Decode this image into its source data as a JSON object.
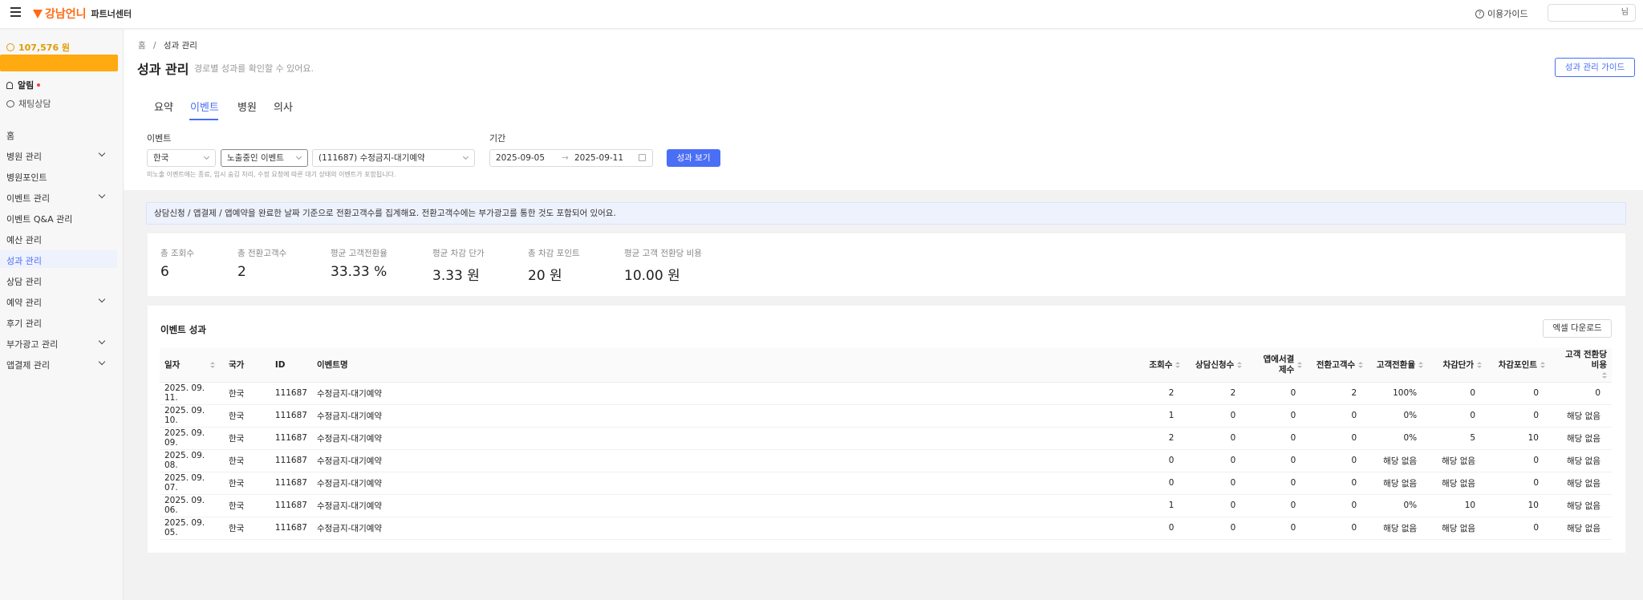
{
  "header": {
    "logo_text": "강남언니",
    "subtitle": "파트너센터",
    "guide_link": "이용가이드",
    "user_suffix": "님",
    "brand_color": "#ff6a13"
  },
  "sidebar": {
    "points": "107,576 원",
    "alarm": "알림",
    "chat": "채팅상담",
    "items": [
      {
        "label": "홈",
        "chevron": false
      },
      {
        "label": "병원 관리",
        "chevron": true
      },
      {
        "label": "병원포인트",
        "chevron": false
      },
      {
        "label": "이벤트 관리",
        "chevron": true
      },
      {
        "label": "이벤트 Q&A 관리",
        "chevron": false
      },
      {
        "label": "예산 관리",
        "chevron": false
      },
      {
        "label": "성과 관리",
        "chevron": false,
        "active": true
      },
      {
        "label": "상담 관리",
        "chevron": false
      },
      {
        "label": "예약 관리",
        "chevron": true
      },
      {
        "label": "후기 관리",
        "chevron": false
      },
      {
        "label": "부가광고 관리",
        "chevron": true
      },
      {
        "label": "앱결제 관리",
        "chevron": true
      }
    ]
  },
  "breadcrumb": {
    "home": "홈",
    "sep": "/",
    "current": "성과 관리"
  },
  "page": {
    "title": "성과 관리",
    "subtitle": "경로별 성과를 확인할 수 있어요.",
    "guide_button": "성과 관리 가이드"
  },
  "tabs": [
    "요약",
    "이벤트",
    "병원",
    "의사"
  ],
  "active_tab": "이벤트",
  "filters": {
    "event_label": "이벤트",
    "period_label": "기간",
    "country": "한국",
    "event_status": "노출중인 이벤트",
    "event_name": "(111687) 수정금지-대기예약",
    "date_from": "2025-09-05",
    "date_to": "2025-09-11",
    "view_button": "성과 보기",
    "note": "미노출 이벤트에는 종료, 임시 숨김 처리, 수정 요청에 따른 대기 상태의 이벤트가 포함됩니다."
  },
  "info_banner": "상담신청 / 앱결제 / 앱예약을 완료한 날짜 기준으로 전환고객수를 집계해요. 전환고객수에는 부가광고를 통한 것도 포함되어 있어요.",
  "kpis": [
    {
      "label": "총 조회수",
      "value": "6"
    },
    {
      "label": "총 전환고객수",
      "value": "2"
    },
    {
      "label": "평균 고객전환율",
      "value": "33.33 %"
    },
    {
      "label": "평균 차감 단가",
      "value": "3.33 원"
    },
    {
      "label": "총 차감 포인트",
      "value": "20 원"
    },
    {
      "label": "평균 고객 전환당 비용",
      "value": "10.00 원"
    }
  ],
  "table": {
    "title": "이벤트 성과",
    "excel_button": "엑셀 다운로드",
    "columns": [
      "일자",
      "국가",
      "ID",
      "이벤트명",
      "조회수",
      "상담신청수",
      "앱에서결제수",
      "전환고객수",
      "고객전환율",
      "차감단가",
      "차감포인트",
      "고객 전환당 비용"
    ],
    "rows": [
      [
        "2025. 09. 11.",
        "한국",
        "111687",
        "수정금지-대기예약",
        "2",
        "2",
        "0",
        "2",
        "100%",
        "0",
        "0",
        "0"
      ],
      [
        "2025. 09. 10.",
        "한국",
        "111687",
        "수정금지-대기예약",
        "1",
        "0",
        "0",
        "0",
        "0%",
        "0",
        "0",
        "해당 없음"
      ],
      [
        "2025. 09. 09.",
        "한국",
        "111687",
        "수정금지-대기예약",
        "2",
        "0",
        "0",
        "0",
        "0%",
        "5",
        "10",
        "해당 없음"
      ],
      [
        "2025. 09. 08.",
        "한국",
        "111687",
        "수정금지-대기예약",
        "0",
        "0",
        "0",
        "0",
        "해당 없음",
        "해당 없음",
        "0",
        "해당 없음"
      ],
      [
        "2025. 09. 07.",
        "한국",
        "111687",
        "수정금지-대기예약",
        "0",
        "0",
        "0",
        "0",
        "해당 없음",
        "해당 없음",
        "0",
        "해당 없음"
      ],
      [
        "2025. 09. 06.",
        "한국",
        "111687",
        "수정금지-대기예약",
        "1",
        "0",
        "0",
        "0",
        "0%",
        "10",
        "10",
        "해당 없음"
      ],
      [
        "2025. 09. 05.",
        "한국",
        "111687",
        "수정금지-대기예약",
        "0",
        "0",
        "0",
        "0",
        "해당 없음",
        "해당 없음",
        "0",
        "해당 없음"
      ]
    ]
  }
}
